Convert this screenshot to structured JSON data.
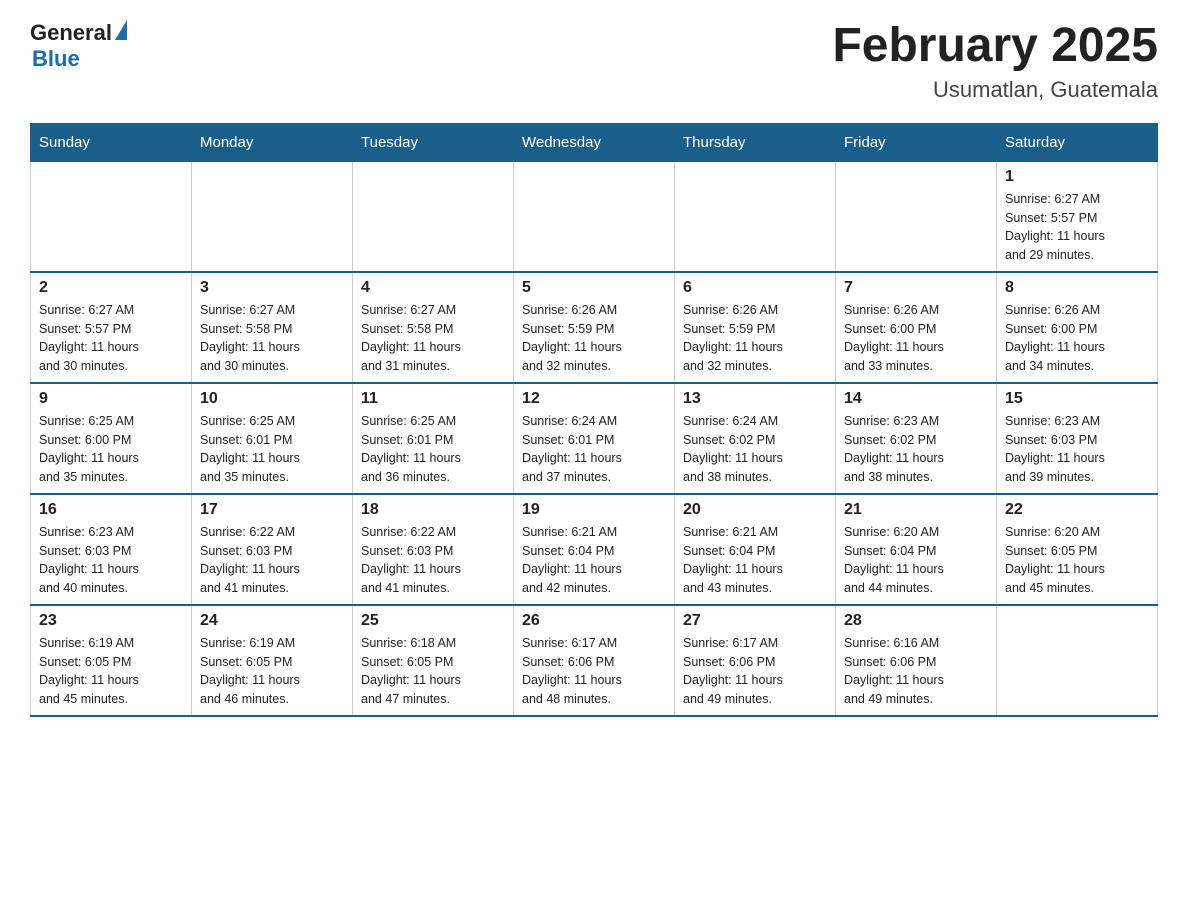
{
  "header": {
    "logo": {
      "general": "General",
      "blue": "Blue"
    },
    "title": "February 2025",
    "location": "Usumatlan, Guatemala"
  },
  "weekdays": [
    "Sunday",
    "Monday",
    "Tuesday",
    "Wednesday",
    "Thursday",
    "Friday",
    "Saturday"
  ],
  "weeks": [
    [
      {
        "day": "",
        "info": ""
      },
      {
        "day": "",
        "info": ""
      },
      {
        "day": "",
        "info": ""
      },
      {
        "day": "",
        "info": ""
      },
      {
        "day": "",
        "info": ""
      },
      {
        "day": "",
        "info": ""
      },
      {
        "day": "1",
        "info": "Sunrise: 6:27 AM\nSunset: 5:57 PM\nDaylight: 11 hours\nand 29 minutes."
      }
    ],
    [
      {
        "day": "2",
        "info": "Sunrise: 6:27 AM\nSunset: 5:57 PM\nDaylight: 11 hours\nand 30 minutes."
      },
      {
        "day": "3",
        "info": "Sunrise: 6:27 AM\nSunset: 5:58 PM\nDaylight: 11 hours\nand 30 minutes."
      },
      {
        "day": "4",
        "info": "Sunrise: 6:27 AM\nSunset: 5:58 PM\nDaylight: 11 hours\nand 31 minutes."
      },
      {
        "day": "5",
        "info": "Sunrise: 6:26 AM\nSunset: 5:59 PM\nDaylight: 11 hours\nand 32 minutes."
      },
      {
        "day": "6",
        "info": "Sunrise: 6:26 AM\nSunset: 5:59 PM\nDaylight: 11 hours\nand 32 minutes."
      },
      {
        "day": "7",
        "info": "Sunrise: 6:26 AM\nSunset: 6:00 PM\nDaylight: 11 hours\nand 33 minutes."
      },
      {
        "day": "8",
        "info": "Sunrise: 6:26 AM\nSunset: 6:00 PM\nDaylight: 11 hours\nand 34 minutes."
      }
    ],
    [
      {
        "day": "9",
        "info": "Sunrise: 6:25 AM\nSunset: 6:00 PM\nDaylight: 11 hours\nand 35 minutes."
      },
      {
        "day": "10",
        "info": "Sunrise: 6:25 AM\nSunset: 6:01 PM\nDaylight: 11 hours\nand 35 minutes."
      },
      {
        "day": "11",
        "info": "Sunrise: 6:25 AM\nSunset: 6:01 PM\nDaylight: 11 hours\nand 36 minutes."
      },
      {
        "day": "12",
        "info": "Sunrise: 6:24 AM\nSunset: 6:01 PM\nDaylight: 11 hours\nand 37 minutes."
      },
      {
        "day": "13",
        "info": "Sunrise: 6:24 AM\nSunset: 6:02 PM\nDaylight: 11 hours\nand 38 minutes."
      },
      {
        "day": "14",
        "info": "Sunrise: 6:23 AM\nSunset: 6:02 PM\nDaylight: 11 hours\nand 38 minutes."
      },
      {
        "day": "15",
        "info": "Sunrise: 6:23 AM\nSunset: 6:03 PM\nDaylight: 11 hours\nand 39 minutes."
      }
    ],
    [
      {
        "day": "16",
        "info": "Sunrise: 6:23 AM\nSunset: 6:03 PM\nDaylight: 11 hours\nand 40 minutes."
      },
      {
        "day": "17",
        "info": "Sunrise: 6:22 AM\nSunset: 6:03 PM\nDaylight: 11 hours\nand 41 minutes."
      },
      {
        "day": "18",
        "info": "Sunrise: 6:22 AM\nSunset: 6:03 PM\nDaylight: 11 hours\nand 41 minutes."
      },
      {
        "day": "19",
        "info": "Sunrise: 6:21 AM\nSunset: 6:04 PM\nDaylight: 11 hours\nand 42 minutes."
      },
      {
        "day": "20",
        "info": "Sunrise: 6:21 AM\nSunset: 6:04 PM\nDaylight: 11 hours\nand 43 minutes."
      },
      {
        "day": "21",
        "info": "Sunrise: 6:20 AM\nSunset: 6:04 PM\nDaylight: 11 hours\nand 44 minutes."
      },
      {
        "day": "22",
        "info": "Sunrise: 6:20 AM\nSunset: 6:05 PM\nDaylight: 11 hours\nand 45 minutes."
      }
    ],
    [
      {
        "day": "23",
        "info": "Sunrise: 6:19 AM\nSunset: 6:05 PM\nDaylight: 11 hours\nand 45 minutes."
      },
      {
        "day": "24",
        "info": "Sunrise: 6:19 AM\nSunset: 6:05 PM\nDaylight: 11 hours\nand 46 minutes."
      },
      {
        "day": "25",
        "info": "Sunrise: 6:18 AM\nSunset: 6:05 PM\nDaylight: 11 hours\nand 47 minutes."
      },
      {
        "day": "26",
        "info": "Sunrise: 6:17 AM\nSunset: 6:06 PM\nDaylight: 11 hours\nand 48 minutes."
      },
      {
        "day": "27",
        "info": "Sunrise: 6:17 AM\nSunset: 6:06 PM\nDaylight: 11 hours\nand 49 minutes."
      },
      {
        "day": "28",
        "info": "Sunrise: 6:16 AM\nSunset: 6:06 PM\nDaylight: 11 hours\nand 49 minutes."
      },
      {
        "day": "",
        "info": ""
      }
    ]
  ]
}
